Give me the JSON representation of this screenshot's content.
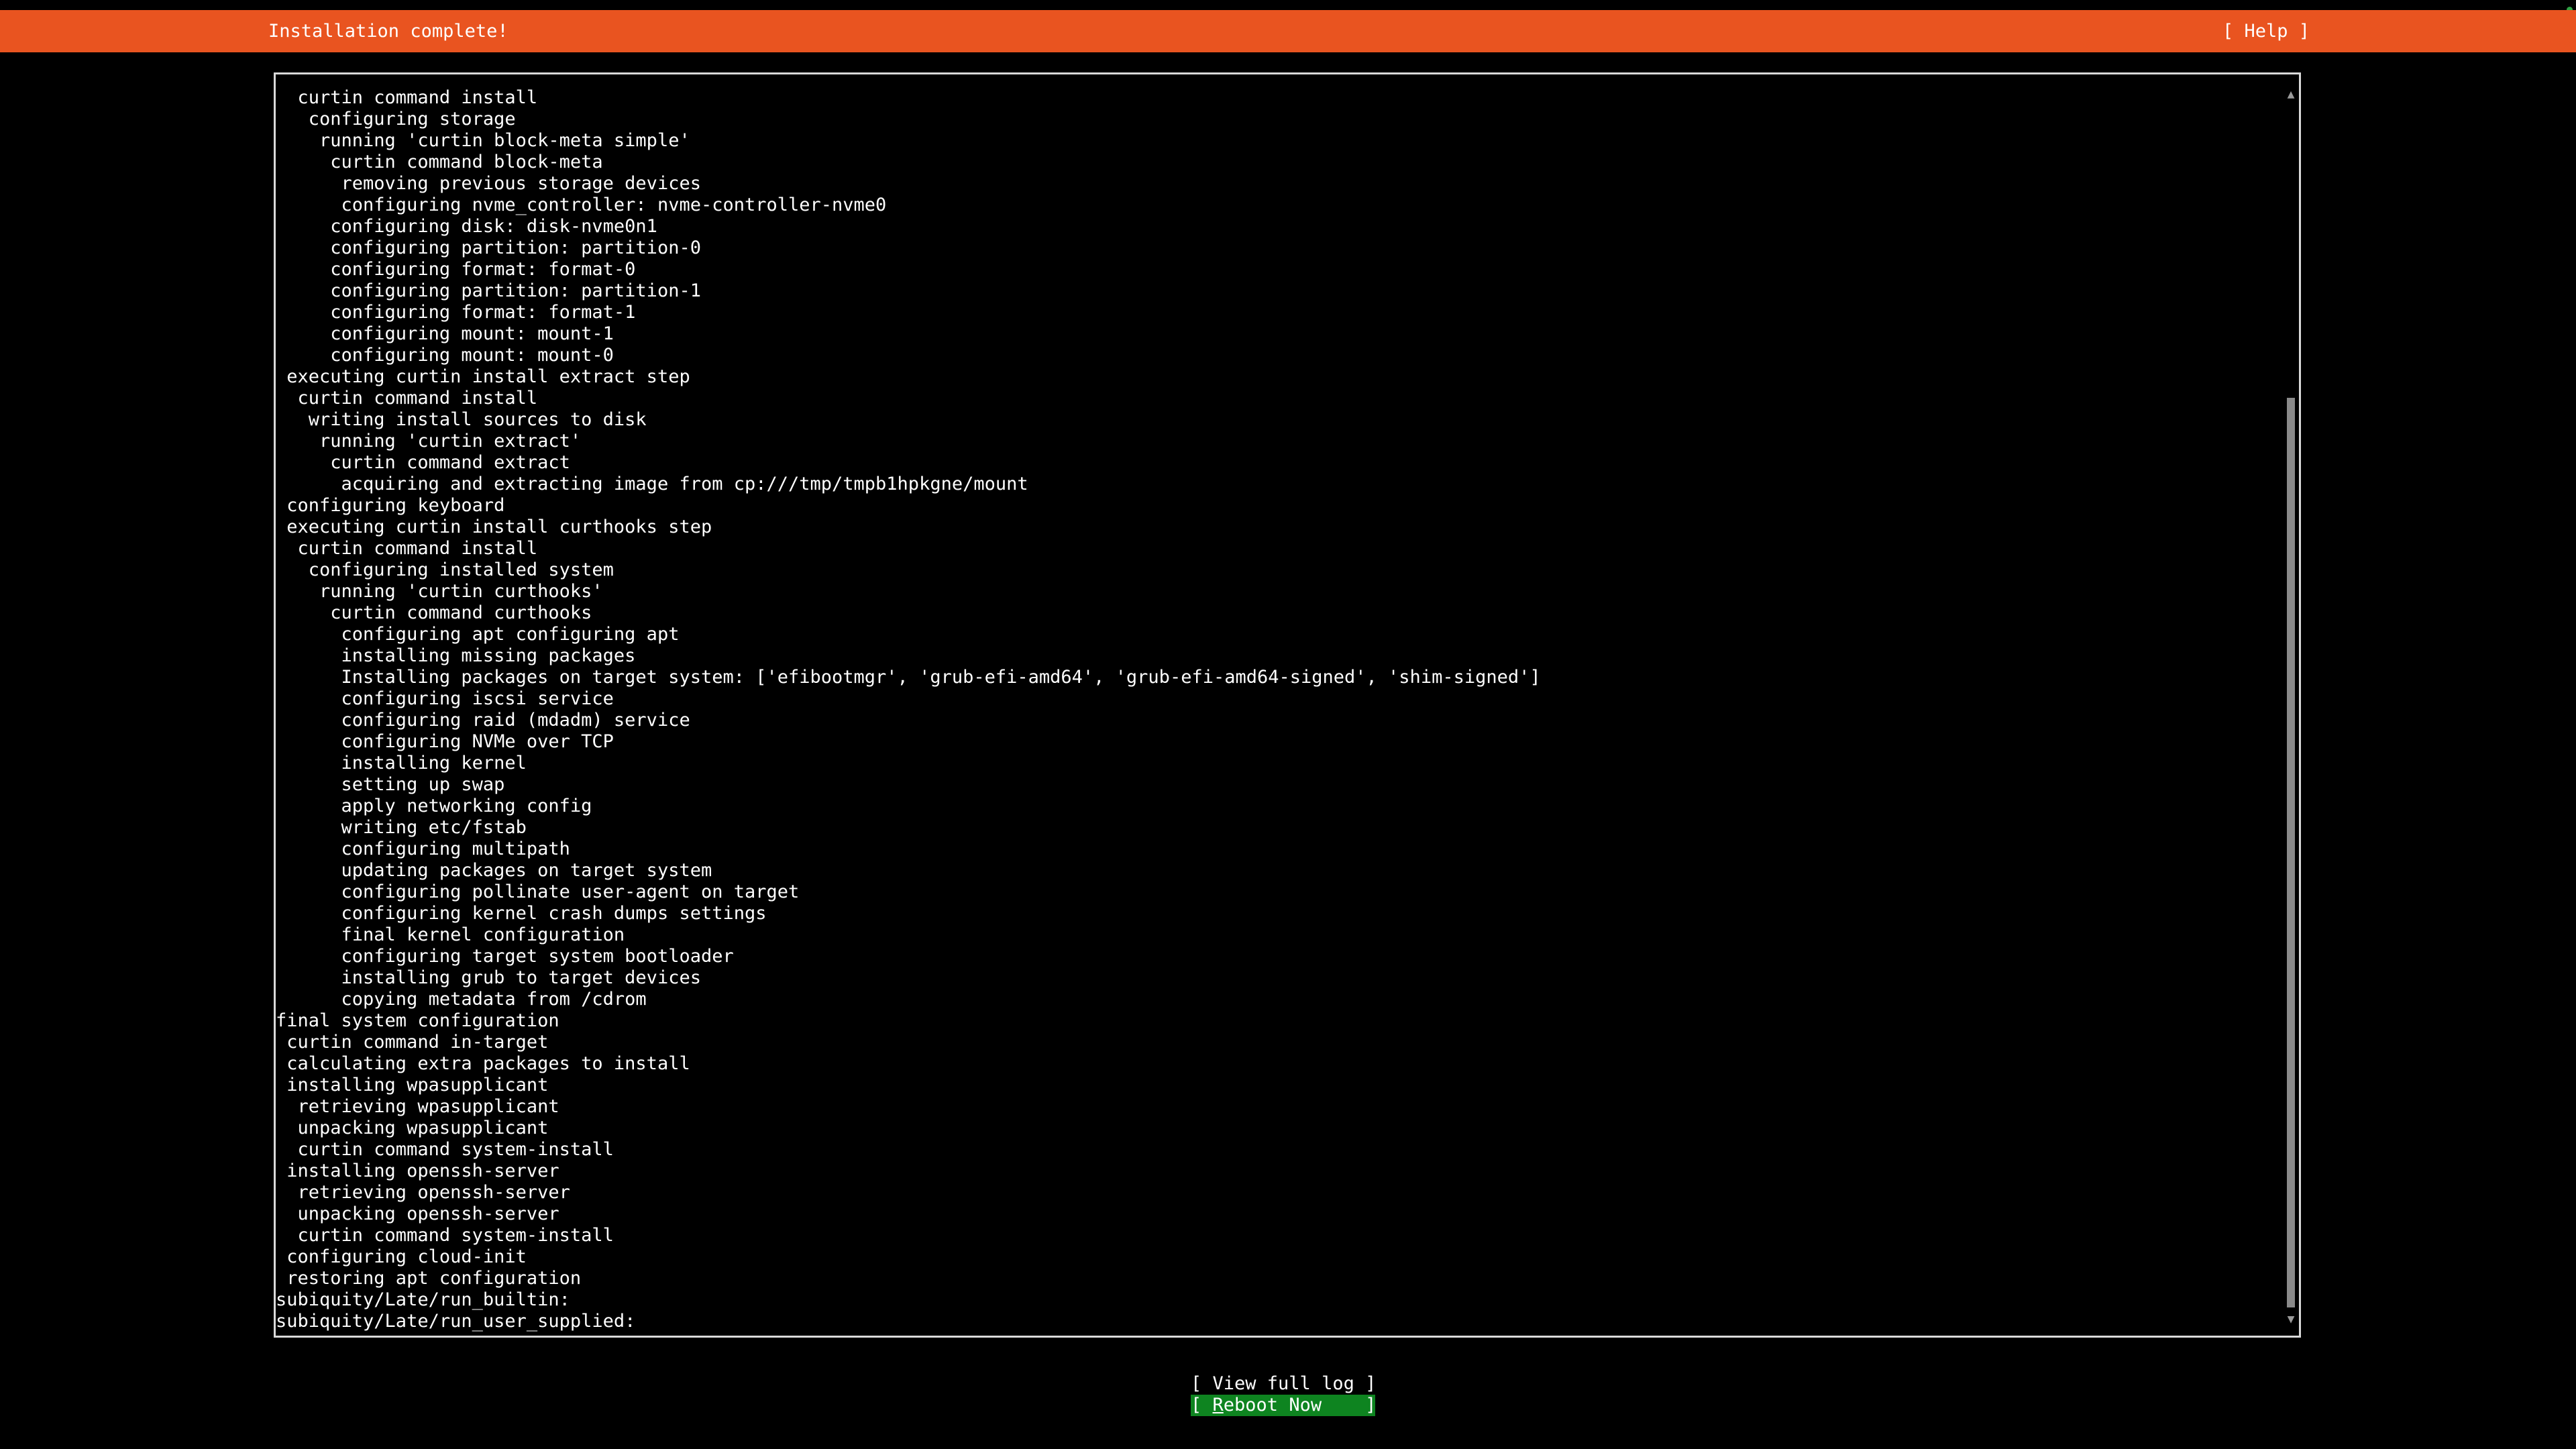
{
  "header": {
    "title": "Installation complete!",
    "help_label": "[ Help ]",
    "background_color": "#e95420"
  },
  "log": {
    "lines": [
      "  curtin command install",
      "   configuring storage",
      "    running 'curtin block-meta simple'",
      "     curtin command block-meta",
      "      removing previous storage devices",
      "      configuring nvme_controller: nvme-controller-nvme0",
      "     configuring disk: disk-nvme0n1",
      "     configuring partition: partition-0",
      "     configuring format: format-0",
      "     configuring partition: partition-1",
      "     configuring format: format-1",
      "     configuring mount: mount-1",
      "     configuring mount: mount-0",
      " executing curtin install extract step",
      "  curtin command install",
      "   writing install sources to disk",
      "    running 'curtin extract'",
      "     curtin command extract",
      "      acquiring and extracting image from cp:///tmp/tmpb1hpkgne/mount",
      " configuring keyboard",
      " executing curtin install curthooks step",
      "  curtin command install",
      "   configuring installed system",
      "    running 'curtin curthooks'",
      "     curtin command curthooks",
      "      configuring apt configuring apt",
      "      installing missing packages",
      "      Installing packages on target system: ['efibootmgr', 'grub-efi-amd64', 'grub-efi-amd64-signed', 'shim-signed']",
      "      configuring iscsi service",
      "      configuring raid (mdadm) service",
      "      configuring NVMe over TCP",
      "      installing kernel",
      "      setting up swap",
      "      apply networking config",
      "      writing etc/fstab",
      "      configuring multipath",
      "      updating packages on target system",
      "      configuring pollinate user-agent on target",
      "      configuring kernel crash dumps settings",
      "      final kernel configuration",
      "      configuring target system bootloader",
      "      installing grub to target devices",
      "      copying metadata from /cdrom",
      "final system configuration",
      " curtin command in-target",
      " calculating extra packages to install",
      " installing wpasupplicant",
      "  retrieving wpasupplicant",
      "  unpacking wpasupplicant",
      "  curtin command system-install",
      " installing openssh-server",
      "  retrieving openssh-server",
      "  unpacking openssh-server",
      "  curtin command system-install",
      " configuring cloud-init",
      " restoring apt configuration",
      "subiquity/Late/run_builtin:",
      "subiquity/Late/run_user_supplied:"
    ]
  },
  "scrollbar": {
    "up_arrow": "▲",
    "down_arrow": "▼",
    "position_fraction": 1.0
  },
  "footer": {
    "view_log_label": "[ View full log ]",
    "reboot": {
      "open": "[ ",
      "hotkey": "R",
      "rest": "eboot Now    ]"
    },
    "focus_color": "#0e8420"
  },
  "corner_indicator_color": "#2ea043"
}
